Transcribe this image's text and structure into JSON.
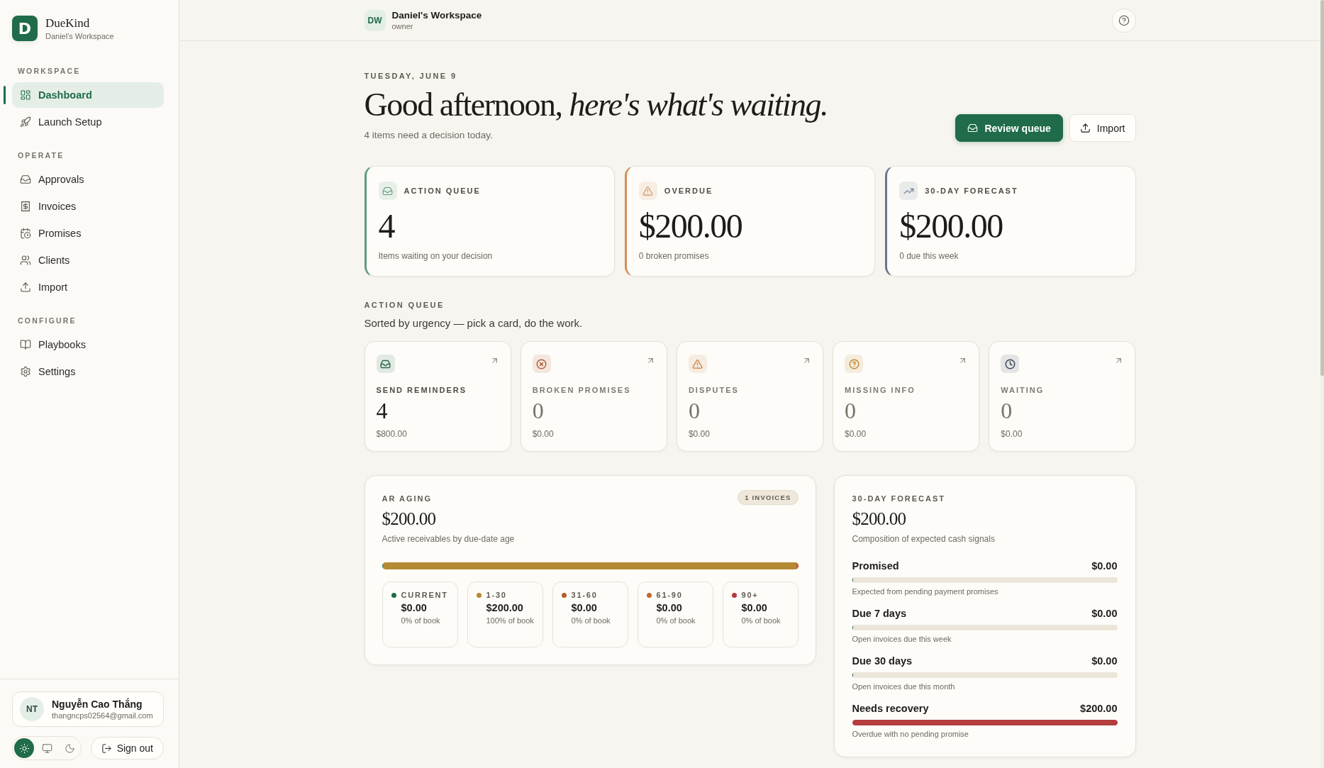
{
  "sidebar": {
    "brand": {
      "mark": "D",
      "name": "DueKind",
      "workspace": "Daniel's Workspace"
    },
    "sections": [
      {
        "label": "WORKSPACE",
        "items": [
          {
            "label": "Dashboard",
            "selected": true
          },
          {
            "label": "Launch Setup",
            "selected": false
          }
        ]
      },
      {
        "label": "OPERATE",
        "items": [
          {
            "label": "Approvals",
            "selected": false
          },
          {
            "label": "Invoices",
            "selected": false
          },
          {
            "label": "Promises",
            "selected": false
          },
          {
            "label": "Clients",
            "selected": false
          },
          {
            "label": "Import",
            "selected": false
          }
        ]
      },
      {
        "label": "CONFIGURE",
        "items": [
          {
            "label": "Playbooks",
            "selected": false
          },
          {
            "label": "Settings",
            "selected": false
          }
        ]
      }
    ],
    "user": {
      "initials": "NT",
      "name": "Nguyễn Cao Thắng",
      "email": "thangncps02564@gmail.com"
    },
    "theme_options": [
      {
        "kind": "light",
        "selected": true
      },
      {
        "kind": "system",
        "selected": false
      },
      {
        "kind": "dark",
        "selected": false
      }
    ],
    "sign_out": "Sign out"
  },
  "header": {
    "workspace": {
      "initials": "DW",
      "name": "Daniel's Workspace",
      "role": "owner"
    }
  },
  "greeting": {
    "date": "TUESDAY, JUNE 9",
    "headline": "Good afternoon, *here's what's waiting.*",
    "subtitle": "4 items need a decision today.",
    "buttons": [
      {
        "kind": "primary",
        "label": "Review queue"
      },
      {
        "kind": "secondary",
        "label": "Import"
      }
    ]
  },
  "stats": [
    {
      "label": "ACTION QUEUE",
      "value": "4",
      "caption": "Items waiting on your decision",
      "color": "#5f9c7c"
    },
    {
      "label": "OVERDUE",
      "value": "$200.00",
      "caption": "0 broken promises",
      "color": "#d38f5a"
    },
    {
      "label": "30-DAY FORECAST",
      "value": "$200.00",
      "caption": "0 due this week",
      "color": "#6a7590"
    }
  ],
  "action_queue": {
    "title": "ACTION QUEUE",
    "subtitle": "Sorted by urgency — pick a card, do the work.",
    "cards": [
      {
        "label": "SEND REMINDERS",
        "count": "4",
        "amount": "$800.00",
        "color": "#2f6e4f",
        "dimmed": false
      },
      {
        "label": "BROKEN PROMISES",
        "count": "0",
        "amount": "$0.00",
        "color": "#b0643a",
        "dimmed": true
      },
      {
        "label": "DISPUTES",
        "count": "0",
        "amount": "$0.00",
        "color": "#c98a4a",
        "dimmed": true
      },
      {
        "label": "MISSING INFO",
        "count": "0",
        "amount": "$0.00",
        "color": "#c48a32",
        "dimmed": true
      },
      {
        "label": "WAITING",
        "count": "0",
        "amount": "$0.00",
        "color": "#3d4a5c",
        "dimmed": true
      }
    ]
  },
  "ar_aging": {
    "title": "AR AGING",
    "total": "$200.00",
    "caption": "Active receivables by due-date age",
    "badge": "1 INVOICES",
    "buckets": [
      {
        "label": "CURRENT",
        "amount": "$0.00",
        "share": "0% of book",
        "level": 0,
        "color": "#1f6b4a"
      },
      {
        "label": "1-30",
        "amount": "$200.00",
        "share": "100% of book",
        "level": 1,
        "color": "#b58a35"
      },
      {
        "label": "31-60",
        "amount": "$0.00",
        "share": "0% of book",
        "level": 0,
        "color": "#b85c2c"
      },
      {
        "label": "61-90",
        "amount": "$0.00",
        "share": "0% of book",
        "level": 0,
        "color": "#c06a30"
      },
      {
        "label": "90+",
        "amount": "$0.00",
        "share": "0% of book",
        "level": 0,
        "color": "#b53a3a"
      }
    ]
  },
  "forecast": {
    "title": "30-DAY FORECAST",
    "total": "$200.00",
    "caption": "Composition of expected cash signals",
    "rows": [
      {
        "label": "Promised",
        "amount": "$0.00",
        "level": 0,
        "note": "Expected from pending payment promises"
      },
      {
        "label": "Due 7 days",
        "amount": "$0.00",
        "level": 0,
        "note": "Open invoices due this week"
      },
      {
        "label": "Due 30 days",
        "amount": "$0.00",
        "level": 0,
        "note": "Open invoices due this month"
      },
      {
        "label": "Needs recovery",
        "amount": "$200.00",
        "level": 1,
        "note": "Overdue with no pending promise",
        "color": "#b43e3e"
      }
    ]
  }
}
